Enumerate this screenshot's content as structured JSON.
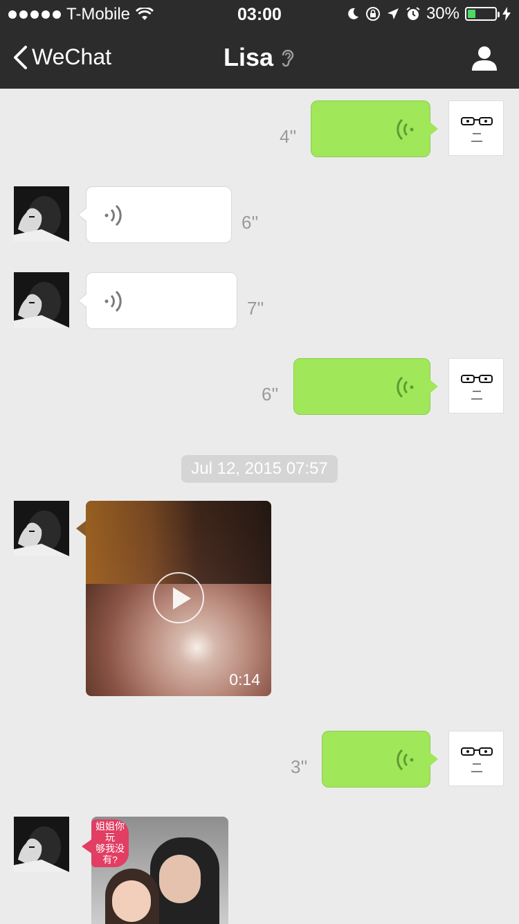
{
  "status_bar": {
    "carrier": "T-Mobile",
    "time": "03:00",
    "battery_percent": "30%",
    "battery_level": 0.3,
    "icons": [
      "signal-dots-icon",
      "wifi-icon",
      "moon-icon",
      "rotation-lock-icon",
      "location-icon",
      "alarm-icon",
      "battery-icon",
      "charging-icon"
    ]
  },
  "nav": {
    "back_label": "WeChat",
    "title": "Lisa",
    "title_icon": "earpiece-icon",
    "right_icon": "contact-profile-icon"
  },
  "messages": [
    {
      "type": "voice",
      "from": "me",
      "duration": "4''"
    },
    {
      "type": "voice",
      "from": "lisa",
      "duration": "6''"
    },
    {
      "type": "voice",
      "from": "lisa",
      "duration": "7''"
    },
    {
      "type": "voice",
      "from": "me",
      "duration": "6''"
    },
    {
      "type": "timestamp",
      "text": "Jul 12, 2015 07:57"
    },
    {
      "type": "video",
      "from": "lisa",
      "duration": "0:14"
    },
    {
      "type": "voice",
      "from": "me",
      "duration": "3''"
    },
    {
      "type": "image",
      "from": "lisa",
      "caption_lines": [
        "姐姐你玩",
        "够我没",
        "有?"
      ]
    }
  ],
  "colors": {
    "nav_bg": "#2c2c2c",
    "chat_bg": "#ebebeb",
    "my_bubble": "#a0e75a",
    "voice_icon_me": "#5f9a32",
    "voice_icon_her": "#7a7a7a",
    "duration_text": "#9a9a9a",
    "battery_fill": "#4cd964"
  }
}
